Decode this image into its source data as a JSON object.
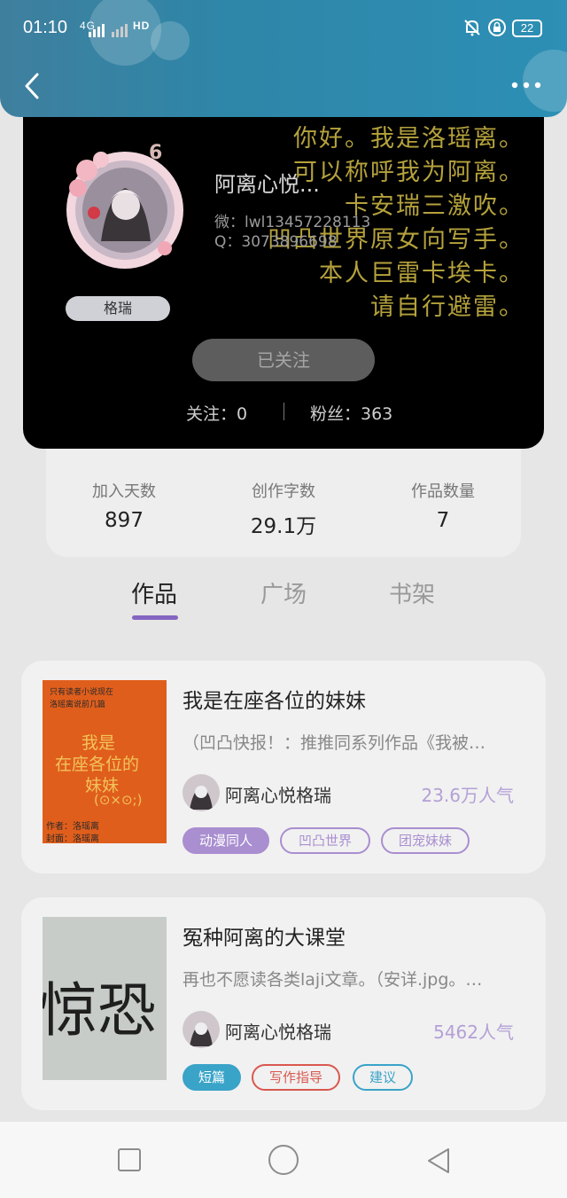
{
  "status": {
    "time": "01:10",
    "signal": "4G",
    "network": "HD",
    "battery": "22"
  },
  "header": {
    "back_icon": "chevron-left-icon",
    "more_icon": "more-dots-icon"
  },
  "profile": {
    "level": "6",
    "tag": "格瑞",
    "nickname": "阿离心悦...",
    "wechat": "微：lwl13457228113",
    "qq": "Q：3073896698",
    "bg_poem": [
      "你好。我是洛瑶离。",
      "可以称呼我为阿离。",
      "卡安瑞三激吹。",
      "凹凸世界原女向写手。",
      "本人巨雷卡埃卡。",
      "请自行避雷。"
    ],
    "follow_button": "已关注",
    "following_label": "关注：0",
    "fans_label": "粉丝：363"
  },
  "stats": [
    {
      "label": "加入天数",
      "value": "897"
    },
    {
      "label": "创作字数",
      "value": "29.1万"
    },
    {
      "label": "作品数量",
      "value": "7"
    }
  ],
  "tabs": [
    {
      "label": "作品",
      "active": true
    },
    {
      "label": "广场",
      "active": false
    },
    {
      "label": "书架",
      "active": false
    }
  ],
  "works": [
    {
      "title": "我是在座各位的妹妹",
      "desc": "（凹凸快报！：推推同系列作品《我被…",
      "author": "阿离心悦格瑞",
      "popularity": "23.6万人气",
      "cover_text": {
        "top": "只有读者小说现在",
        "line2": "洛瑶离说前几篇",
        "main1": "我是",
        "main2": "在座各位的",
        "main3": "妹妹",
        "face": "(⊙×⊙;)",
        "writer": "作者：洛瑶离",
        "cover_by": "封面：洛瑶离"
      },
      "tags": [
        {
          "label": "动漫同人",
          "style": "filled",
          "color": "#a98ed0"
        },
        {
          "label": "凹凸世界",
          "style": "outline",
          "color": "#a98ed0"
        },
        {
          "label": "团宠妹妹",
          "style": "outline",
          "color": "#a98ed0"
        }
      ]
    },
    {
      "title": "冤种阿离的大课堂",
      "desc": "再也不愿读各类laji文章。（安详.jpg。…",
      "author": "阿离心悦格瑞",
      "popularity": "5462人气",
      "cover_text": {
        "main": "惊恐"
      },
      "tags": [
        {
          "label": "短篇",
          "style": "filled",
          "color": "#3aa3c8"
        },
        {
          "label": "写作指导",
          "style": "outline",
          "color": "#d9584f"
        },
        {
          "label": "建议",
          "style": "outline",
          "color": "#3aa3c8"
        }
      ]
    }
  ],
  "navbar": {
    "recent_icon": "square-icon",
    "home_icon": "circle-icon",
    "back_icon": "triangle-back-icon"
  }
}
